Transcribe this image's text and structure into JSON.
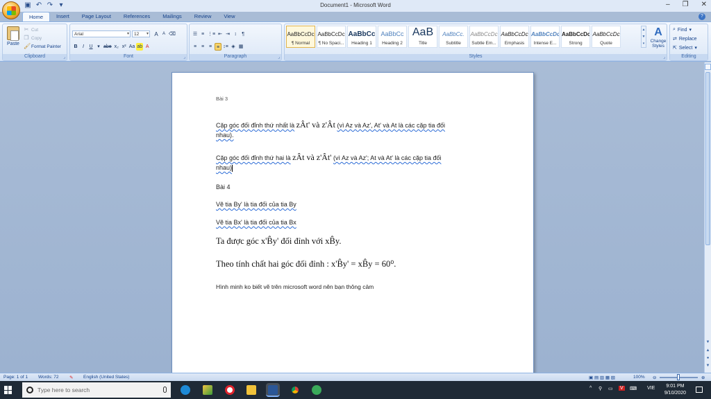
{
  "window": {
    "title": "Document1 - Microsoft Word",
    "controls": [
      "–",
      "❐",
      "✕"
    ]
  },
  "tabs": [
    "Home",
    "Insert",
    "Page Layout",
    "References",
    "Mailings",
    "Review",
    "View"
  ],
  "ribbon": {
    "clipboard": {
      "paste": "Paste",
      "cut": "Cut",
      "copy": "Copy",
      "format_painter": "Format Painter",
      "label": "Clipboard"
    },
    "font": {
      "name": "Arial",
      "size": "12",
      "label": "Font",
      "bold": "B",
      "italic": "I",
      "underline": "U",
      "strike": "abe",
      "sub": "x₂",
      "sup": "x²",
      "case": "Aa",
      "grow": "A",
      "shrink": "A"
    },
    "paragraph": {
      "label": "Paragraph"
    },
    "styles": {
      "label": "Styles",
      "items": [
        {
          "sample": "AaBbCcDc",
          "name": "¶ Normal"
        },
        {
          "sample": "AaBbCcDc",
          "name": "¶ No Spaci..."
        },
        {
          "sample": "AaBbCc",
          "name": "Heading 1"
        },
        {
          "sample": "AaBbCc",
          "name": "Heading 2"
        },
        {
          "sample": "AaB",
          "name": "Title"
        },
        {
          "sample": "AaBbCc.",
          "name": "Subtitle"
        },
        {
          "sample": "AaBbCcDc",
          "name": "Subtle Em..."
        },
        {
          "sample": "AaBbCcDc",
          "name": "Emphasis"
        },
        {
          "sample": "AaBbCcDc",
          "name": "Intense E..."
        },
        {
          "sample": "AaBbCcDc",
          "name": "Strong"
        },
        {
          "sample": "AaBbCcDc",
          "name": "Quote"
        }
      ],
      "change_styles": "Change Styles"
    },
    "editing": {
      "label": "Editing",
      "find": "Find",
      "replace": "Replace",
      "select": "Select"
    }
  },
  "document": {
    "bai3": "Bài 3",
    "p1_text": "Cặp góc đối đỉnh thứ nhất là",
    "p1_math": "zÂt' và z'Ât",
    "p1_rest": "(vì Az và Az', At' và At là các cặp tia đối",
    "p1_end": "nhau).",
    "p2_text": "Cặp góc đối đỉnh thứ hai là",
    "p2_math": "zÂt và z'Ât'",
    "p2_rest": "(vì Az và Az'; At và At' là các cặp tia đối",
    "p2_end": "nhau)",
    "bai4": "Bài 4",
    "l1": "Vẽ tia By' là tia đối của tia By",
    "l2": "Vẽ tia Bx' là tia đối của tia Bx",
    "m1_text": "Ta được góc",
    "m1_a": "x'B̂y'",
    "m1_mid": "đối đỉnh với",
    "m1_b": "xB̂y",
    "m1_end": ".",
    "m2_text": "Theo tính chất hai góc đối đỉnh :",
    "m2_math": "x'B̂y' = xB̂y = 60⁰.",
    "last": "Hình minh ko biết vẽ trên microsoft word nên bạn thông cảm"
  },
  "statusbar": {
    "page": "Page: 1 of 1",
    "words": "Words: 72",
    "language": "English (United States)",
    "zoom": "100%"
  },
  "taskbar": {
    "search_placeholder": "Type here to search",
    "lang": "VIE",
    "time": "9:01 PM",
    "date": "9/10/2020"
  }
}
